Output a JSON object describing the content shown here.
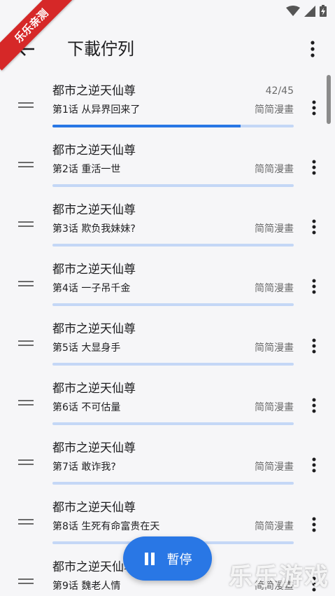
{
  "corner_badge": "乐乐亲测",
  "app_bar": {
    "title": "下載佇列"
  },
  "colors": {
    "accent": "#2977e5",
    "track": "#c4d7f6"
  },
  "queue": [
    {
      "manga": "都市之逆天仙尊",
      "chapter": "第1话 从异界回来了",
      "source": "简简漫畫",
      "progress_label": "42/45",
      "progress": 0.78
    },
    {
      "manga": "都市之逆天仙尊",
      "chapter": "第2话 重活一世",
      "source": "简简漫畫",
      "progress_label": "",
      "progress": 0
    },
    {
      "manga": "都市之逆天仙尊",
      "chapter": "第3话 欺负我妹妹?",
      "source": "简简漫畫",
      "progress_label": "",
      "progress": 0
    },
    {
      "manga": "都市之逆天仙尊",
      "chapter": "第4话 一子吊千金",
      "source": "简简漫畫",
      "progress_label": "",
      "progress": 0
    },
    {
      "manga": "都市之逆天仙尊",
      "chapter": "第5话 大显身手",
      "source": "简简漫畫",
      "progress_label": "",
      "progress": 0
    },
    {
      "manga": "都市之逆天仙尊",
      "chapter": "第6话 不可估量",
      "source": "简简漫畫",
      "progress_label": "",
      "progress": 0
    },
    {
      "manga": "都市之逆天仙尊",
      "chapter": "第7话 敢诈我?",
      "source": "简简漫畫",
      "progress_label": "",
      "progress": 0
    },
    {
      "manga": "都市之逆天仙尊",
      "chapter": "第8话 生死有命富贵在天",
      "source": "简简漫畫",
      "progress_label": "",
      "progress": 0
    },
    {
      "manga": "都市之逆天仙尊",
      "chapter": "第9话 魏老人情",
      "source": "简简漫畫",
      "progress_label": "",
      "progress": 0
    }
  ],
  "fab": {
    "label": "暫停",
    "icon": "pause-icon"
  },
  "watermark": "乐乐游戏"
}
